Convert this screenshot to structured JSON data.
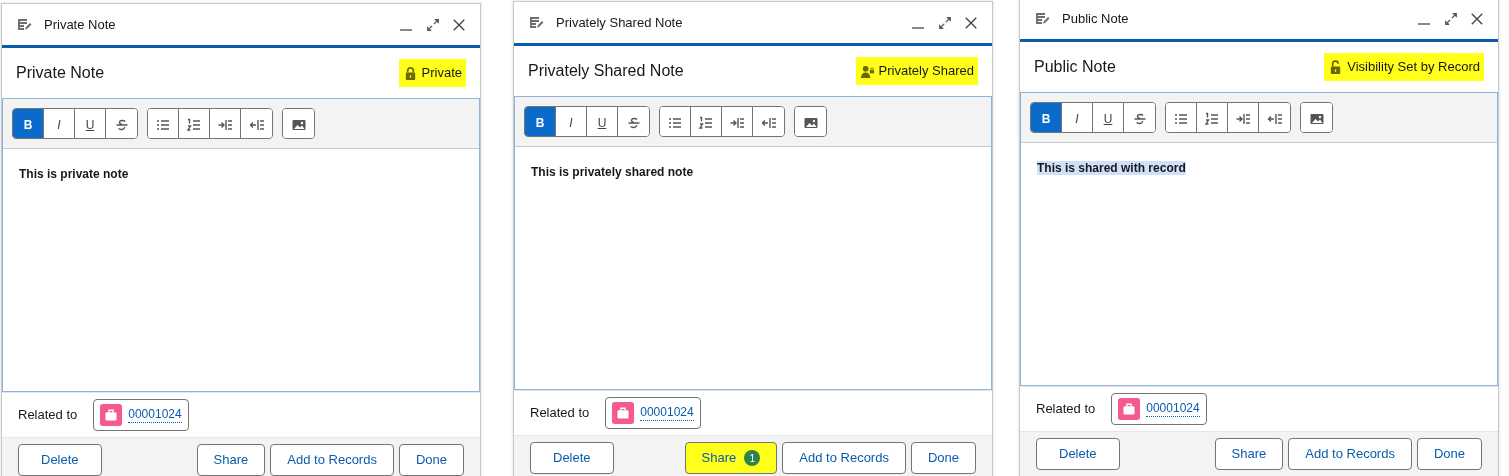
{
  "panels": [
    {
      "title": "Private Note",
      "subject": "Private Note",
      "visibility": {
        "kind": "lock",
        "label": "Private",
        "highlighted": true
      },
      "toolbar": [
        [
          {
            "kind": "bold",
            "label": "B",
            "selected": true
          },
          {
            "kind": "italic",
            "label": "I",
            "selected": false
          },
          {
            "kind": "underline",
            "label": "U",
            "selected": false
          },
          {
            "kind": "strike",
            "selected": false
          }
        ],
        [
          {
            "kind": "bullets",
            "selected": false
          },
          {
            "kind": "numbers",
            "selected": false
          },
          {
            "kind": "indent",
            "selected": false
          },
          {
            "kind": "outdent",
            "selected": false
          }
        ],
        [
          {
            "kind": "image",
            "selected": false
          }
        ]
      ],
      "body": {
        "text": "This is private note",
        "selected": false
      },
      "related_label": "Related to",
      "related_record": "00001024",
      "buttons": [
        {
          "label": "Delete",
          "highlighted": false
        },
        {
          "label": "Share",
          "highlighted": false
        },
        {
          "label": "Add to Records",
          "highlighted": false
        },
        {
          "label": "Done",
          "highlighted": false
        }
      ]
    },
    {
      "title": "Privately Shared Note",
      "subject": "Privately Shared Note",
      "visibility": {
        "kind": "person-lock",
        "label": "Privately Shared",
        "highlighted": true
      },
      "toolbar": [
        [
          {
            "kind": "bold",
            "label": "B",
            "selected": true
          },
          {
            "kind": "italic",
            "label": "I",
            "selected": false
          },
          {
            "kind": "underline",
            "label": "U",
            "selected": false
          },
          {
            "kind": "strike",
            "selected": false
          }
        ],
        [
          {
            "kind": "bullets",
            "selected": false
          },
          {
            "kind": "numbers",
            "selected": false
          },
          {
            "kind": "indent",
            "selected": false
          },
          {
            "kind": "outdent",
            "selected": false
          }
        ],
        [
          {
            "kind": "image",
            "selected": false
          }
        ]
      ],
      "body": {
        "text": "This is privately shared note",
        "selected": false
      },
      "related_label": "Related to",
      "related_record": "00001024",
      "buttons": [
        {
          "label": "Delete",
          "highlighted": false
        },
        {
          "label": "Share",
          "badge": "1",
          "highlighted": true
        },
        {
          "label": "Add to Records",
          "highlighted": false
        },
        {
          "label": "Done",
          "highlighted": false
        }
      ]
    },
    {
      "title": "Public Note",
      "subject": "Public Note",
      "visibility": {
        "kind": "lock-open",
        "label": "Visibility Set by Record",
        "highlighted": true
      },
      "toolbar": [
        [
          {
            "kind": "bold",
            "label": "B",
            "selected": true
          },
          {
            "kind": "italic",
            "label": "I",
            "selected": false
          },
          {
            "kind": "underline",
            "label": "U",
            "selected": false
          },
          {
            "kind": "strike",
            "selected": false
          }
        ],
        [
          {
            "kind": "bullets",
            "selected": false
          },
          {
            "kind": "numbers",
            "selected": false
          },
          {
            "kind": "indent",
            "selected": false
          },
          {
            "kind": "outdent",
            "selected": false
          }
        ],
        [
          {
            "kind": "image",
            "selected": false
          }
        ]
      ],
      "body": {
        "text": "This is shared with record",
        "selected": true
      },
      "related_label": "Related to",
      "related_record": "00001024",
      "buttons": [
        {
          "label": "Delete",
          "highlighted": false
        },
        {
          "label": "Share",
          "highlighted": false
        },
        {
          "label": "Add to Records",
          "highlighted": false
        },
        {
          "label": "Done",
          "highlighted": false
        }
      ]
    }
  ]
}
